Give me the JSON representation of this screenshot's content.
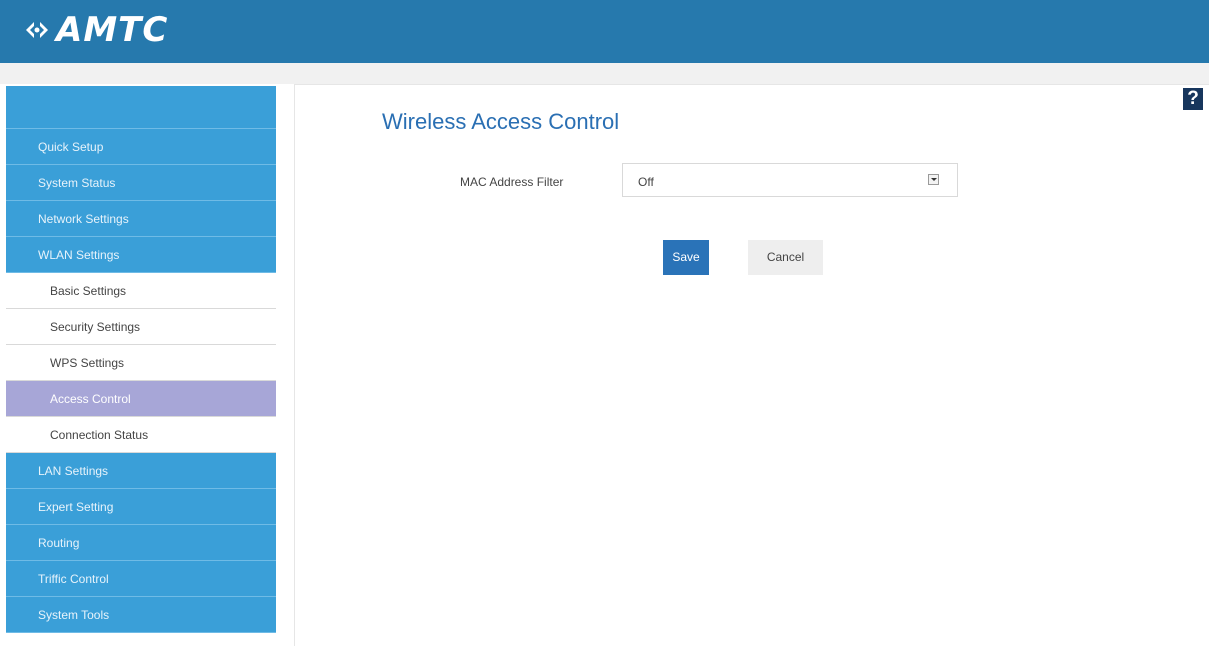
{
  "header": {
    "brand": "AMTC",
    "bar_color": "#2679ad"
  },
  "sidebar": {
    "items": [
      {
        "label": "Quick Setup",
        "level": "main"
      },
      {
        "label": "System Status",
        "level": "main"
      },
      {
        "label": "Network Settings",
        "level": "main"
      },
      {
        "label": "WLAN Settings",
        "level": "main"
      },
      {
        "label": "Basic Settings",
        "level": "sub"
      },
      {
        "label": "Security Settings",
        "level": "sub"
      },
      {
        "label": "WPS Settings",
        "level": "sub"
      },
      {
        "label": "Access Control",
        "level": "sub",
        "active": true
      },
      {
        "label": "Connection Status",
        "level": "sub"
      },
      {
        "label": "LAN Settings",
        "level": "main"
      },
      {
        "label": "Expert Setting",
        "level": "main"
      },
      {
        "label": "Routing",
        "level": "main"
      },
      {
        "label": "Triffic Control",
        "level": "main"
      },
      {
        "label": "System Tools",
        "level": "main"
      }
    ],
    "main_color": "#3a9fd8",
    "active_color": "#a7a6d7"
  },
  "main": {
    "help_label": "?",
    "title": "Wireless Access Control",
    "mac_filter": {
      "label": "MAC Address Filter",
      "value": "Off"
    },
    "save_label": "Save",
    "cancel_label": "Cancel",
    "title_color": "#2a6fb3"
  }
}
